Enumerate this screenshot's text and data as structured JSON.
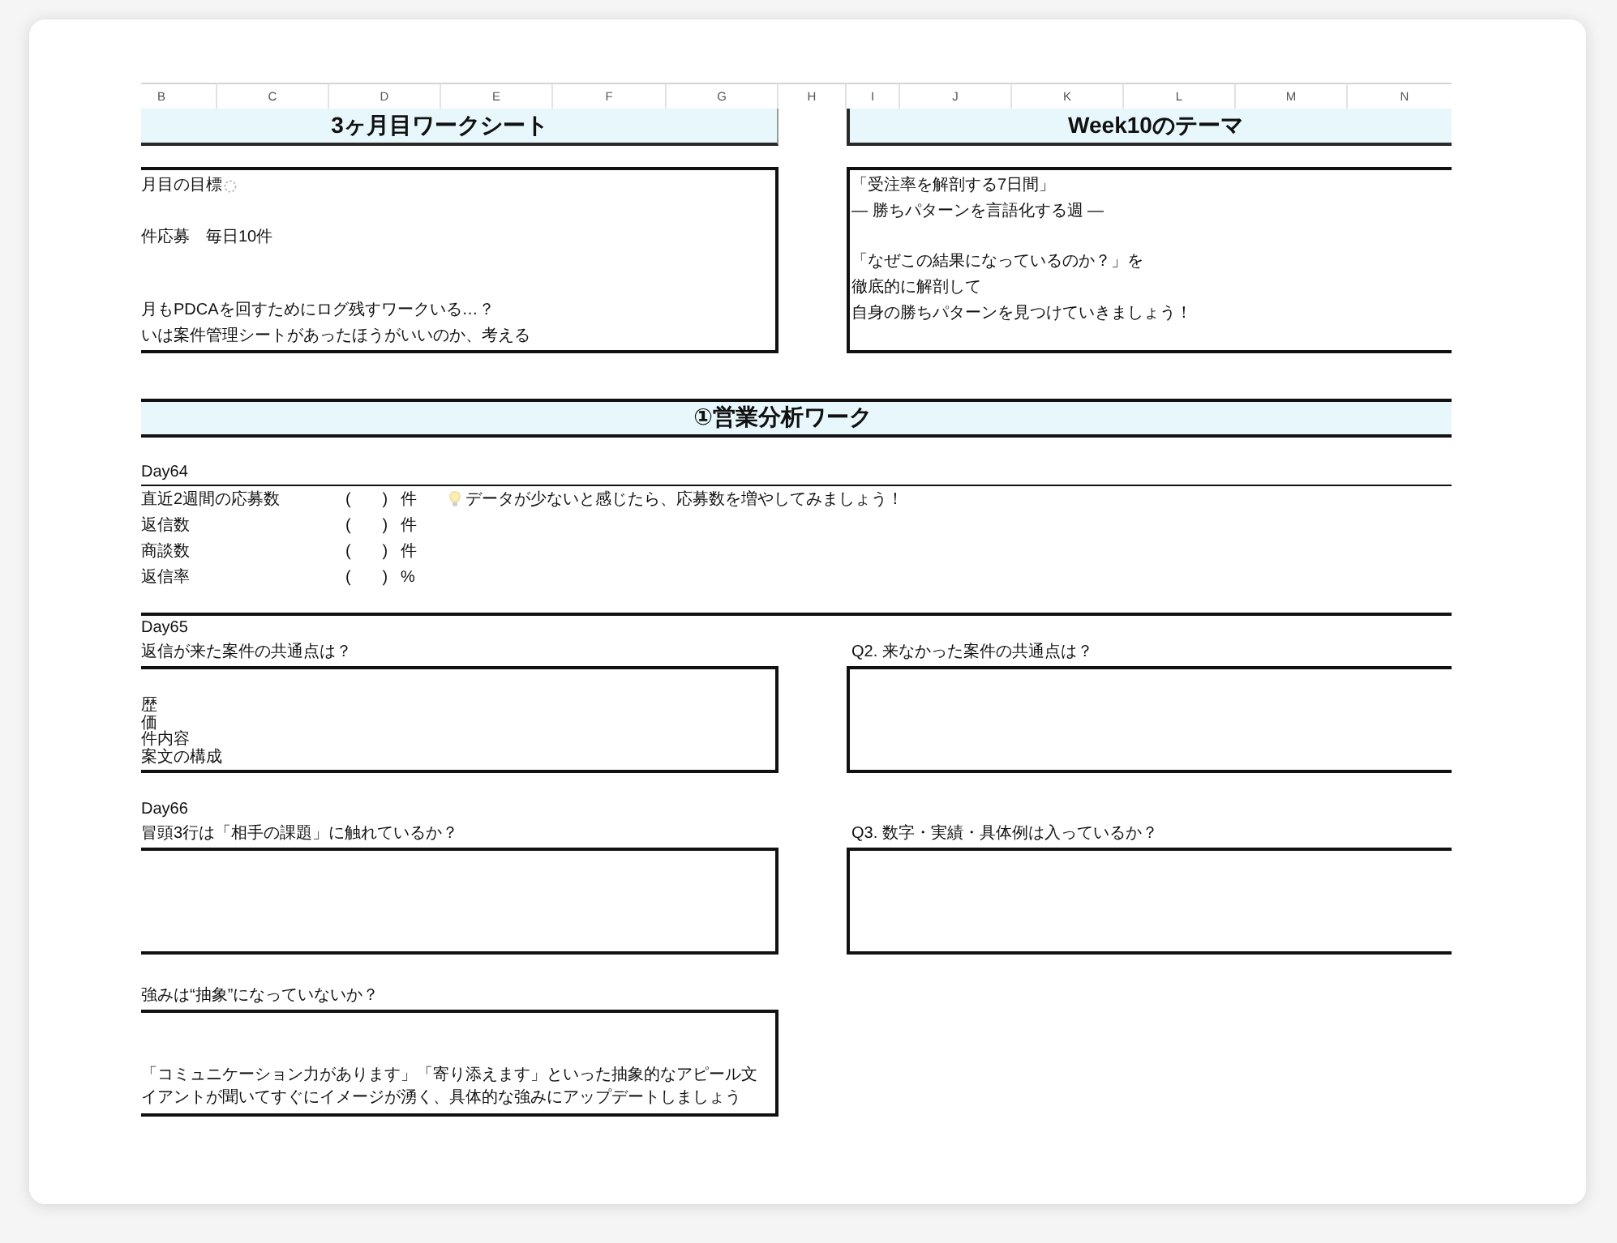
{
  "column_headers": [
    "B",
    "C",
    "D",
    "E",
    "F",
    "G",
    "H",
    "I",
    "J",
    "K",
    "L",
    "M",
    "N"
  ],
  "worksheet_panel": {
    "title": "3ヶ月目ワークシート",
    "goal_label": "月目の目標",
    "goal": "件応募　毎日10件",
    "notes": [
      "月もPDCAを回すためにログ残すワークいる…？",
      "いは案件管理シートがあったほうがいいのか、考える"
    ]
  },
  "theme_panel": {
    "title": "Week10のテーマ",
    "headline": [
      "「受注率を解剖する7日間」",
      "— 勝ちパターンを言語化する週 —"
    ],
    "body": [
      "「なぜこの結果になっているのか？」を",
      "徹底的に解剖して",
      "自身の勝ちパターンを見つけていきましょう！"
    ]
  },
  "analysis_section": {
    "title": "①営業分析ワーク",
    "days": [
      {
        "kind": "metrics",
        "label": "Day64",
        "metrics": [
          {
            "name": "直近2週間の応募数",
            "blank": "(       )",
            "unit": "件"
          },
          {
            "name": "返信数",
            "blank": "(       )",
            "unit": "件"
          },
          {
            "name": "商談数",
            "blank": "(       )",
            "unit": "件"
          },
          {
            "name": "返信率",
            "blank": "(       )",
            "unit": "%"
          }
        ],
        "tip": "データが少ないと感じたら、応募数を増やしてみましょう！"
      },
      {
        "kind": "questions",
        "label": "Day65",
        "rows": [
          {
            "questions": [
              {
                "prompt": "返信が来た案件の共通点は？",
                "lines": [
                  "歴",
                  "価",
                  "件内容",
                  "案文の構成"
                ]
              },
              {
                "prompt": "Q2. 来なかった案件の共通点は？"
              }
            ]
          }
        ]
      },
      {
        "kind": "questions",
        "label": "Day66",
        "rows": [
          {
            "questions": [
              {
                "prompt": "冒頭3行は「相手の課題」に触れているか？"
              },
              {
                "prompt": "Q3. 数字・実績・具体例は入っているか？"
              }
            ]
          },
          {
            "questions": [
              {
                "prompt": "強みは“抽象”になっていないか？",
                "lines": [
                  "「コミュニケーション力があります」「寄り添えます」といった抽象的なアピール文",
                  "イアントが聞いてすぐにイメージが湧く、具体的な強みにアップデートしましょう"
                ]
              }
            ]
          }
        ]
      }
    ]
  }
}
